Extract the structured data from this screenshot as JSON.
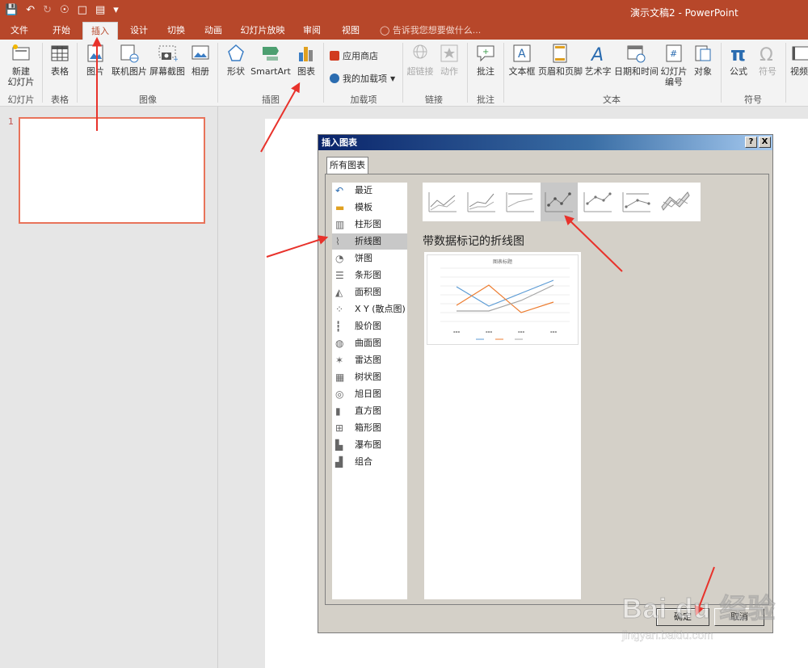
{
  "window": {
    "title": "演示文稿2 - PowerPoint"
  },
  "tabs": [
    {
      "label": "文件",
      "active": false
    },
    {
      "label": "开始",
      "active": false
    },
    {
      "label": "插入",
      "active": true
    },
    {
      "label": "设计",
      "active": false
    },
    {
      "label": "切换",
      "active": false
    },
    {
      "label": "动画",
      "active": false
    },
    {
      "label": "幻灯片放映",
      "active": false
    },
    {
      "label": "审阅",
      "active": false
    },
    {
      "label": "视图",
      "active": false
    }
  ],
  "tell_me": "告诉我您想要做什么...",
  "ribbon": {
    "new_slide": "新建\n幻灯片",
    "table": "表格",
    "picture": "图片",
    "online_picture": "联机图片",
    "screenshot": "屏幕截图",
    "album": "相册",
    "shapes": "形状",
    "smartart": "SmartArt",
    "chart": "图表",
    "store": "应用商店",
    "my_addins": "我的加载项",
    "hyperlink": "超链接",
    "action": "动作",
    "comment": "批注",
    "textbox": "文本框",
    "header_footer": "页眉和页脚",
    "wordart": "艺术字",
    "date_time": "日期和时间",
    "slide_number": "幻灯片\n编号",
    "object": "对象",
    "equation": "公式",
    "symbol": "符号",
    "video": "视频",
    "groups": {
      "slides": "幻灯片",
      "tables": "表格",
      "images": "图像",
      "illustrations": "插图",
      "addins": "加载项",
      "links": "链接",
      "comments": "批注",
      "text": "文本",
      "symbols": "符号"
    }
  },
  "slide_pane": {
    "slide_number": "1"
  },
  "dialog": {
    "title": "插入图表",
    "help_btn": "?",
    "close_btn": "X",
    "tab_all": "所有图表",
    "chart_types": [
      {
        "label": "最近",
        "icon": "recent-icon"
      },
      {
        "label": "模板",
        "icon": "folder-icon"
      },
      {
        "label": "柱形图",
        "icon": "column-chart-icon"
      },
      {
        "label": "折线图",
        "icon": "line-chart-icon"
      },
      {
        "label": "饼图",
        "icon": "pie-chart-icon"
      },
      {
        "label": "条形图",
        "icon": "bar-chart-icon"
      },
      {
        "label": "面积图",
        "icon": "area-chart-icon"
      },
      {
        "label": "X Y (散点图)",
        "icon": "scatter-chart-icon"
      },
      {
        "label": "股价图",
        "icon": "stock-chart-icon"
      },
      {
        "label": "曲面图",
        "icon": "surface-chart-icon"
      },
      {
        "label": "雷达图",
        "icon": "radar-chart-icon"
      },
      {
        "label": "树状图",
        "icon": "treemap-chart-icon"
      },
      {
        "label": "旭日图",
        "icon": "sunburst-chart-icon"
      },
      {
        "label": "直方图",
        "icon": "histogram-chart-icon"
      },
      {
        "label": "箱形图",
        "icon": "boxwhisker-chart-icon"
      },
      {
        "label": "瀑布图",
        "icon": "waterfall-chart-icon"
      },
      {
        "label": "组合",
        "icon": "combo-chart-icon"
      }
    ],
    "selected_type": "折线图",
    "subtype_title": "带数据标记的折线图",
    "preview_title": "图表标题",
    "footer_btn1": "确定",
    "footer_btn2": "取消"
  },
  "watermark": {
    "brand": "Bai du 经验",
    "url": "jingyan.baidu.com"
  },
  "colors": {
    "accent": "#b7472a",
    "arrow": "#e8322b",
    "series1": "#5b9bd5",
    "series2": "#ed7d31",
    "series3": "#a5a5a5"
  }
}
